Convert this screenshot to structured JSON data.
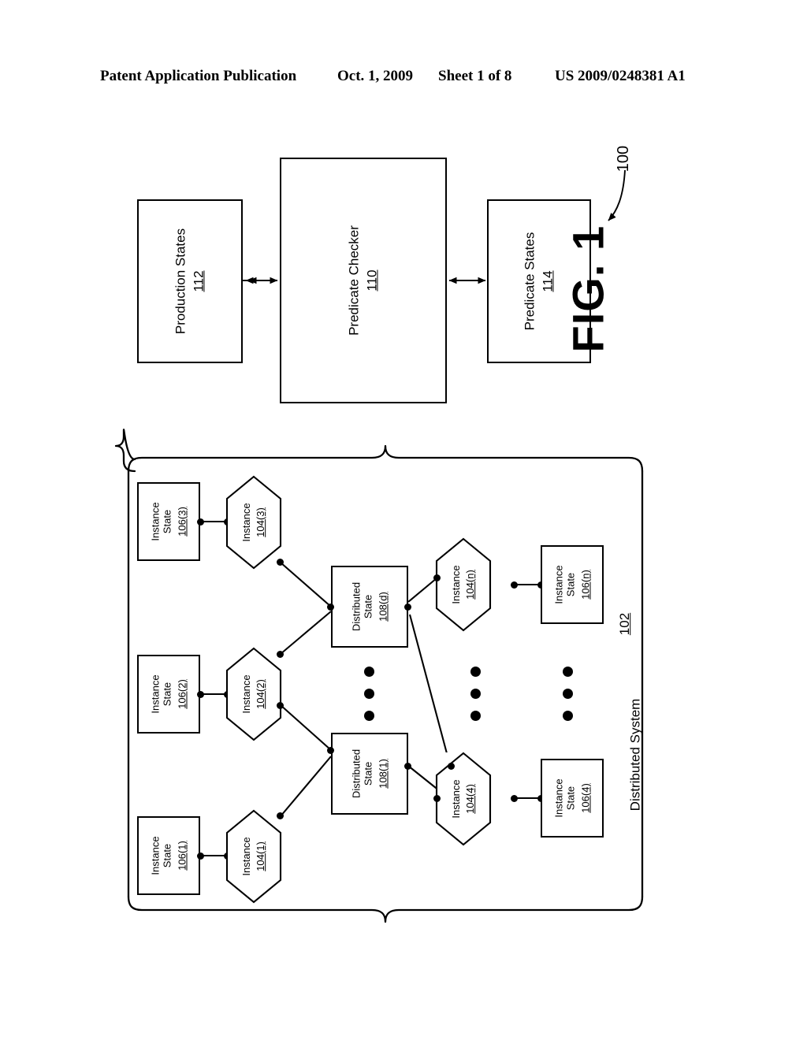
{
  "header": {
    "publication": "Patent Application Publication",
    "date": "Oct. 1, 2009",
    "sheet": "Sheet 1 of 8",
    "patent_number": "US 2009/0248381 A1"
  },
  "figure": {
    "label": "FIG. 1",
    "system_reference": "100"
  },
  "top_diagram": {
    "production_states": {
      "title": "Production States",
      "ref": "112"
    },
    "predicate_checker": {
      "title": "Predicate Checker",
      "ref": "110"
    },
    "predicate_states": {
      "title": "Predicate States",
      "ref": "114"
    }
  },
  "distributed_system": {
    "label": "Distributed System",
    "ref": "102",
    "instance_states": [
      {
        "title": "Instance State",
        "ref": "106(3)"
      },
      {
        "title": "Instance State",
        "ref": "106(2)"
      },
      {
        "title": "Instance State",
        "ref": "106(1)"
      },
      {
        "title": "Instance State",
        "ref": "106(n)"
      },
      {
        "title": "Instance State",
        "ref": "106(4)"
      }
    ],
    "instances": [
      {
        "title": "Instance",
        "ref": "104(3)"
      },
      {
        "title": "Instance",
        "ref": "104(2)"
      },
      {
        "title": "Instance",
        "ref": "104(1)"
      },
      {
        "title": "Instance",
        "ref": "104(n)"
      },
      {
        "title": "Instance",
        "ref": "104(4)"
      }
    ],
    "distributed_states": [
      {
        "title": "Distributed State",
        "line1": "Distributed",
        "line2": "State",
        "ref": "108(d)"
      },
      {
        "title": "Distributed State",
        "line1": "Distributed",
        "line2": "State",
        "ref": "108(1)"
      }
    ]
  }
}
